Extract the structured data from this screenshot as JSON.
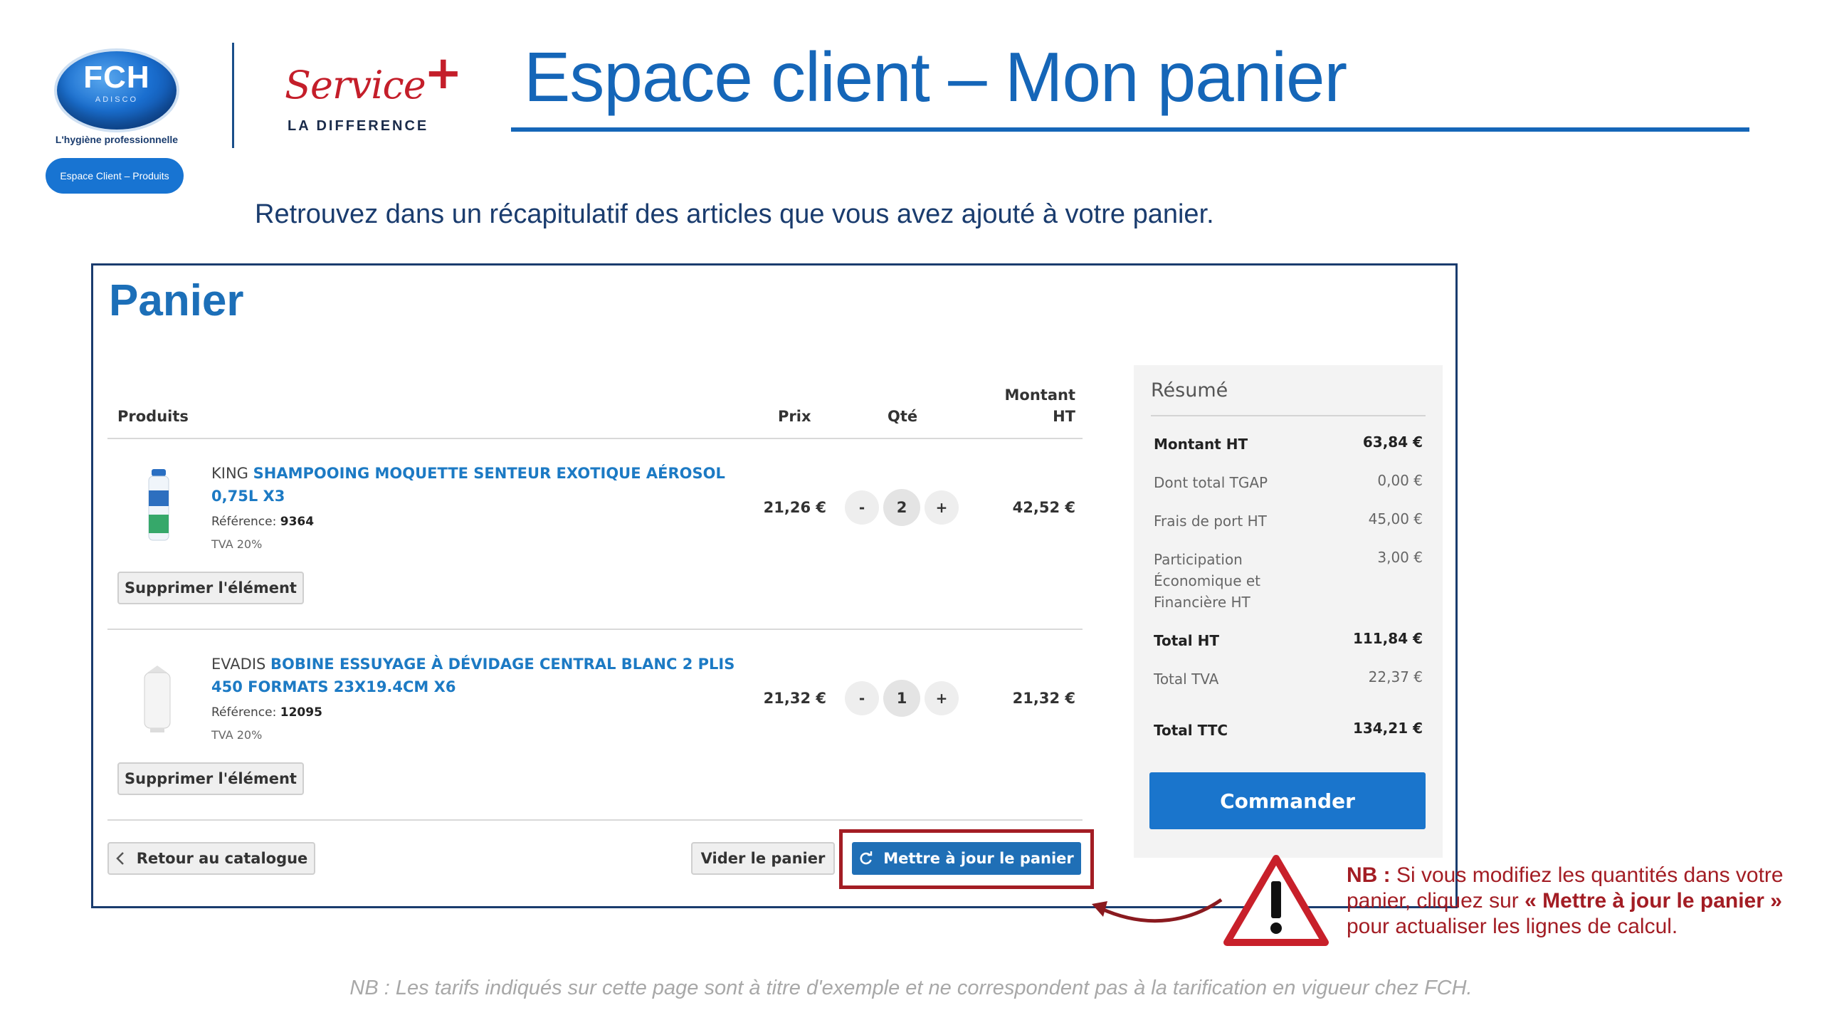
{
  "branding": {
    "fch_name": "FCH",
    "fch_sub": "ADISCO",
    "fch_tagline": "L'hygiène professionnelle",
    "section_pill": "Espace Client – Produits",
    "service_word": "Service",
    "service_plus": "+",
    "service_sub": "LA DIFFERENCE"
  },
  "header": {
    "title": "Espace client – Mon panier"
  },
  "intro": "Retrouvez dans un récapitulatif des articles que vous avez ajouté à votre panier.",
  "cart": {
    "title": "Panier",
    "columns": {
      "products": "Produits",
      "price": "Prix",
      "qty": "Qté",
      "amount_line1": "Montant",
      "amount_line2": "HT"
    },
    "items": [
      {
        "brand": "KING",
        "name": "SHAMPOOING MOQUETTE SENTEUR EXOTIQUE AÉROSOL 0,75L X3",
        "ref_label": "Référence:",
        "ref": "9364",
        "tva": "TVA 20%",
        "price": "21,26 €",
        "qty": "2",
        "minus": "-",
        "plus": "+",
        "amount": "42,52 €",
        "remove": "Supprimer l'élément"
      },
      {
        "brand": "EVADIS",
        "name": "BOBINE ESSUYAGE À DÉVIDAGE CENTRAL BLANC 2 PLIS 450 FORMATS 23X19.4CM X6",
        "ref_label": "Référence:",
        "ref": "12095",
        "tva": "TVA 20%",
        "price": "21,32 €",
        "qty": "1",
        "minus": "-",
        "plus": "+",
        "amount": "21,32 €",
        "remove": "Supprimer l'élément"
      }
    ],
    "back_label": "Retour au catalogue",
    "back_icon": "chevron-left-icon",
    "empty_label": "Vider le panier",
    "update_label": "Mettre à jour le panier",
    "update_icon": "refresh-icon"
  },
  "summary": {
    "title": "Résumé",
    "rows": [
      {
        "label": "Montant HT",
        "value": "63,84 €",
        "bold": true
      },
      {
        "label": "Dont total TGAP",
        "value": "0,00 €",
        "bold": false
      },
      {
        "label": "Frais de port HT",
        "value": "45,00 €",
        "bold": false
      },
      {
        "label": "Participation Économique et Financière HT",
        "value": "3,00 €",
        "bold": false
      },
      {
        "label": "Total HT",
        "value": "111,84 €",
        "bold": true
      },
      {
        "label": "Total TVA",
        "value": "22,37 €",
        "bold": false
      },
      {
        "label": "Total TTC",
        "value": "134,21 €",
        "bold": true
      }
    ],
    "order_label": "Commander"
  },
  "note": {
    "nb": "NB :",
    "text1": " Si vous modifiez les quantités dans votre panier, cliquez sur ",
    "emph": "« Mettre à jour le panier »",
    "text2": " pour actualiser les lignes de calcul.",
    "color": "#a31d24"
  },
  "footer": "NB : Les tarifs indiqués sur cette page sont à titre d'exemple et ne correspondent pas à la tarification en vigueur chez FCH.",
  "colors": {
    "title_blue": "#1566b8",
    "link_blue": "#1c7ac4",
    "button_blue": "#1f6fb6",
    "alert_red": "#a31d24"
  }
}
